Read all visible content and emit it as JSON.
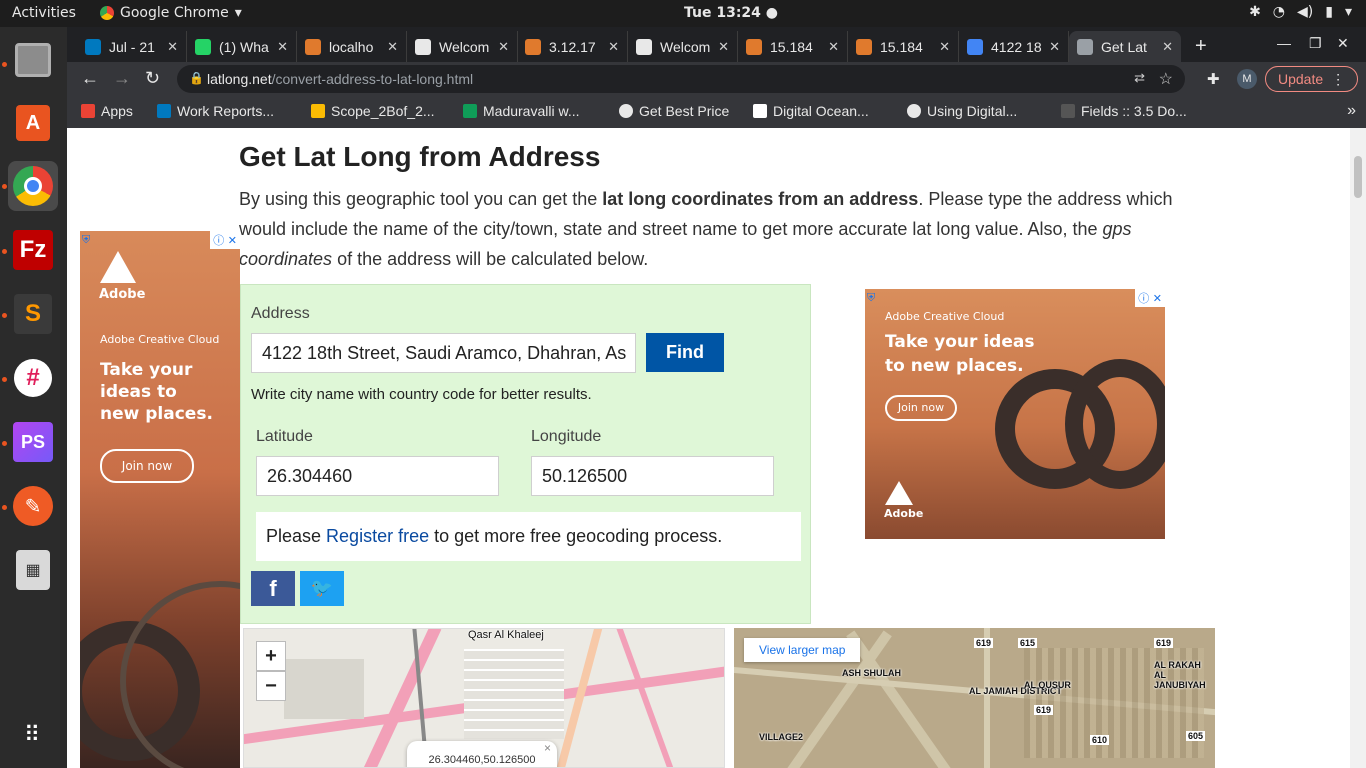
{
  "system": {
    "activities": "Activities",
    "app_name": "Google Chrome",
    "clock": "Tue 13:24 ●"
  },
  "tabs": [
    {
      "label": "Jul - 21",
      "favicon_color": "#0079bf"
    },
    {
      "label": "(1) Wha",
      "favicon_color": "#25d366"
    },
    {
      "label": "localho",
      "favicon_color": "#e07a2d"
    },
    {
      "label": "Welcom",
      "favicon_color": "#e8e8e8"
    },
    {
      "label": "3.12.17",
      "favicon_color": "#e07a2d"
    },
    {
      "label": "Welcom",
      "favicon_color": "#e8e8e8"
    },
    {
      "label": "15.184",
      "favicon_color": "#e07a2d"
    },
    {
      "label": "15.184",
      "favicon_color": "#e07a2d"
    },
    {
      "label": "4122 18",
      "favicon_color": "#4285f4"
    },
    {
      "label": "Get Lat",
      "favicon_color": "#9aa0a6"
    }
  ],
  "toolbar": {
    "url_host": "latlong.net",
    "url_path": "/convert-address-to-lat-long.html",
    "update_label": "Update",
    "profile_initial": "M"
  },
  "bookmarks": [
    {
      "label": "Apps",
      "color": "#ea4335"
    },
    {
      "label": "Work Reports...",
      "color": "#0079bf"
    },
    {
      "label": "Scope_2Bof_2...",
      "color": "#fbbc04"
    },
    {
      "label": "Maduravalli w...",
      "color": "#0f9d58"
    },
    {
      "label": "Get Best Price",
      "color": "#e8e8e8"
    },
    {
      "label": "Digital Ocean...",
      "color": "#ffffff"
    },
    {
      "label": "Using Digital...",
      "color": "#e8e8e8"
    },
    {
      "label": "Fields :: 3.5 Do...",
      "color": "#555555"
    }
  ],
  "page": {
    "title": "Get Lat Long from Address",
    "intro_part1": "By using this geographic tool you can get the ",
    "intro_bold": "lat long coordinates from an address",
    "intro_part2": ". Please type the address which would include the name of the city/town, state and street name to get more accurate lat long value. Also, the ",
    "intro_italic": "gps coordinates",
    "intro_part3": " of the address will be calculated below."
  },
  "form": {
    "address_label": "Address",
    "address_value": "4122 18th Street, Saudi Aramco, Dhahran, As",
    "find_label": "Find",
    "hint": "Write city name with country code for better results.",
    "latitude_label": "Latitude",
    "latitude_value": "26.304460",
    "longitude_label": "Longitude",
    "longitude_value": "50.126500",
    "register_prefix": "Please ",
    "register_link": "Register free",
    "register_suffix": " to get more free geocoding process."
  },
  "share": {
    "facebook_glyph": "f",
    "twitter_glyph": "🐦"
  },
  "ads": {
    "left": {
      "brand": "Adobe",
      "product": "Adobe Creative Cloud",
      "headline": "Take your ideas to new places.",
      "cta": "Join now"
    },
    "right": {
      "brand": "Adobe",
      "product": "Adobe Creative Cloud",
      "headline": "Take your ideas to new places.",
      "cta": "Join now"
    }
  },
  "map_left": {
    "label_top": "Qasr Al Khaleej",
    "zoom_in": "+",
    "zoom_out": "−",
    "popup_text": "26.304460,50.126500",
    "popup_close": "×"
  },
  "map_right": {
    "view_larger": "View larger map",
    "labels": [
      "ASH SHULAH",
      "AL JAMIAH DISTRICT",
      "AL QUSUR",
      "AL RAKAH AL JANUBIYAH",
      "VILLAGE2"
    ],
    "road_numbers": [
      "619",
      "615",
      "619",
      "619",
      "610",
      "605"
    ]
  },
  "colors": {
    "form_bg": "#dff7d7",
    "find_btn": "#0055a5",
    "facebook": "#3b5998",
    "twitter": "#1da1f2",
    "link": "#0a4aa0",
    "update_accent": "#f28b82"
  }
}
